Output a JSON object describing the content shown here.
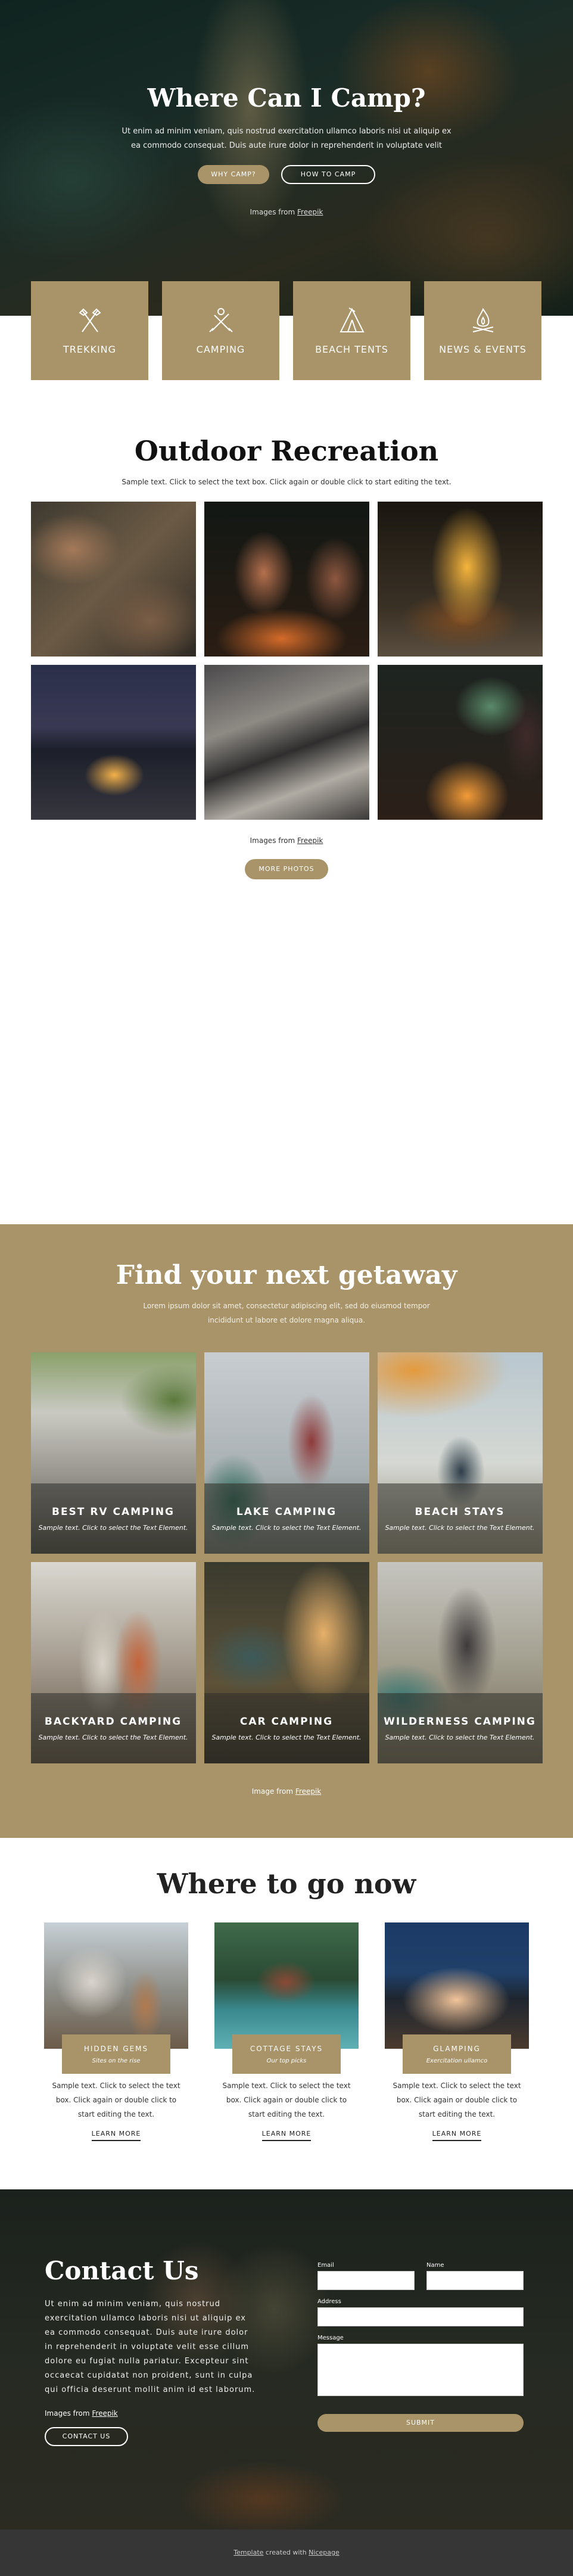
{
  "hero": {
    "title": "Where Can I Camp?",
    "text": "Ut enim ad minim veniam, quis nostrud exercitation ullamco laboris nisi ut aliquip ex ea commodo consequat. Duis aute irure dolor in reprehenderit in voluptate velit",
    "btn_why": "WHY CAMP?",
    "btn_how": "HOW TO CAMP",
    "credit_prefix": "Images from ",
    "credit_link": "Freepik"
  },
  "tiles": [
    {
      "label": "TREKKING",
      "icon": "axes-icon"
    },
    {
      "label": "CAMPING",
      "icon": "tools-icon"
    },
    {
      "label": "BEACH TENTS",
      "icon": "tent-icon"
    },
    {
      "label": "NEWS & EVENTS",
      "icon": "campfire-icon"
    }
  ],
  "outdoor": {
    "title": "Outdoor Recreation",
    "subtitle": "Sample text. Click to select the text box. Click again or double click to start editing the text.",
    "credit_prefix": "Images from ",
    "credit_link": "Freepik",
    "more_btn": "MORE PHOTOS"
  },
  "getaway": {
    "title": "Find your next getaway",
    "lead": "Lorem ipsum dolor sit amet, consectetur adipiscing elit, sed do eiusmod tempor incididunt ut labore et dolore magna aliqua.",
    "cards": [
      {
        "title": "BEST RV CAMPING",
        "text": "Sample text. Click to select the Text Element."
      },
      {
        "title": "LAKE CAMPING",
        "text": "Sample text. Click to select the Text Element."
      },
      {
        "title": "BEACH STAYS",
        "text": "Sample text. Click to select the Text Element."
      },
      {
        "title": "BACKYARD CAMPING",
        "text": "Sample text. Click to select the Text Element."
      },
      {
        "title": "CAR CAMPING",
        "text": "Sample text. Click to select the Text Element."
      },
      {
        "title": "WILDERNESS CAMPING",
        "text": "Sample text. Click to select the Text Element."
      }
    ],
    "credit_prefix": "Image from ",
    "credit_link": "Freepik"
  },
  "where": {
    "title": "Where to go now",
    "items": [
      {
        "title": "HIDDEN GEMS",
        "sub": "Sites on the rise",
        "text": "Sample text. Click to select the text box. Click again or double click to start editing the text.",
        "link": "LEARN MORE"
      },
      {
        "title": "COTTAGE STAYS",
        "sub": "Our top picks",
        "text": "Sample text. Click to select the text box. Click again or double click to start editing the text.",
        "link": "LEARN MORE"
      },
      {
        "title": "GLAMPING",
        "sub": "Exercitation ullamco",
        "text": "Sample text. Click to select the text box. Click again or double click to start editing the text.",
        "link": "LEARN MORE"
      }
    ]
  },
  "contact": {
    "title": "Contact Us",
    "body": "Ut enim ad minim veniam, quis nostrud exercitation ullamco laboris nisi ut aliquip ex ea commodo consequat. Duis aute irure dolor in reprehenderit in voluptate velit esse cillum dolore eu fugiat nulla pariatur. Excepteur sint occaecat cupidatat non proident, sunt in culpa qui officia deserunt mollit anim id est laborum.",
    "credit_prefix": "Images from ",
    "credit_link": "Freepik",
    "btn": "CONTACT US",
    "form": {
      "email_label": "Email",
      "name_label": "Name",
      "address_label": "Address",
      "message_label": "Message",
      "submit": "SUBMIT"
    }
  },
  "footer": {
    "link1": "Template",
    "middle": " created with ",
    "link2": "Nicepage"
  },
  "colors": {
    "accent": "#a89468",
    "footer": "#363636"
  }
}
